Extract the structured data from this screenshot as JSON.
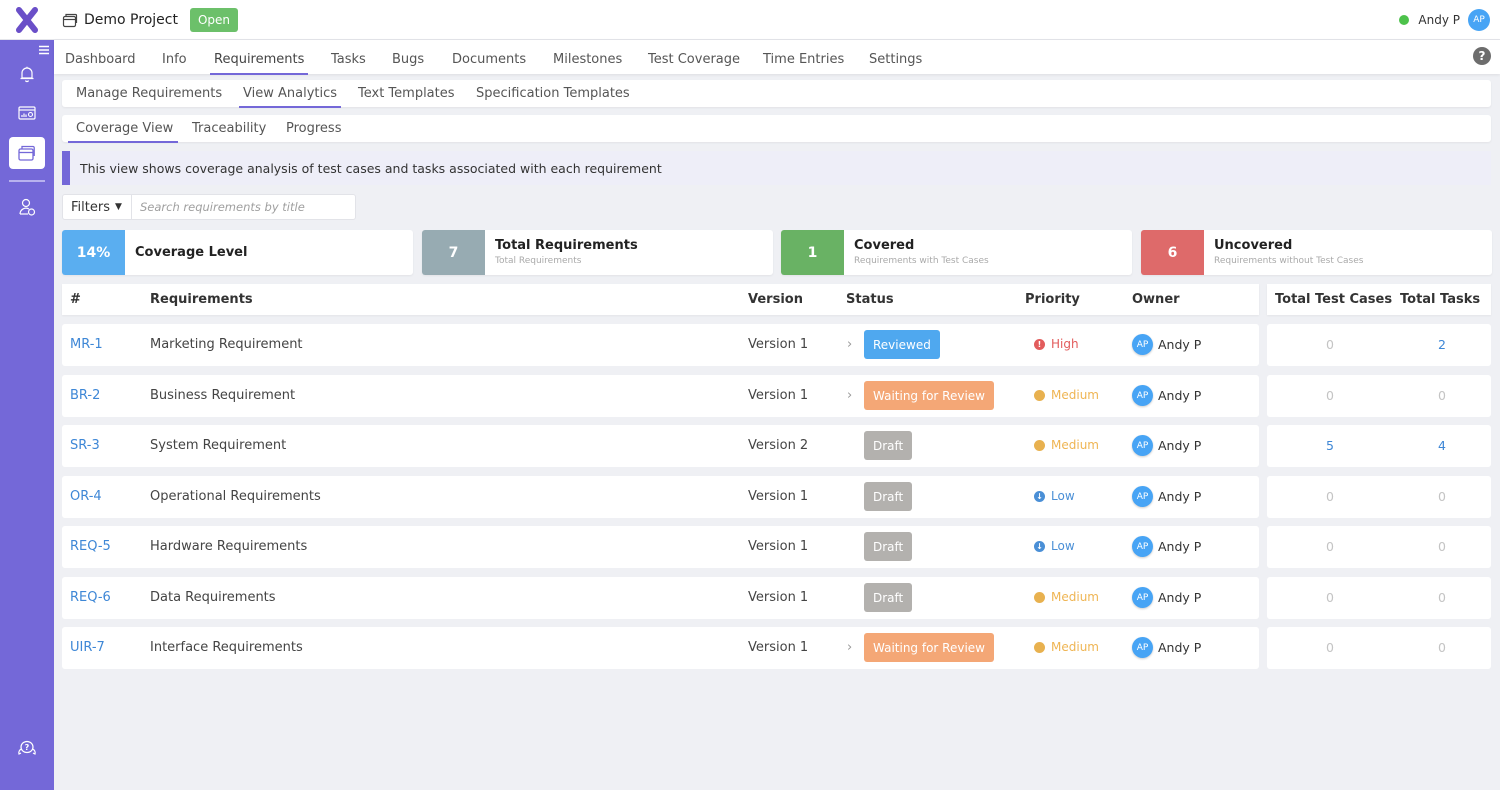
{
  "app": {
    "logo_letter": "X"
  },
  "header": {
    "project_name": "Demo Project",
    "project_status": "Open",
    "user_name": "Andy P",
    "user_initials": "AP"
  },
  "sidebar": {
    "items": [
      {
        "name": "notifications",
        "icon": "bell-icon"
      },
      {
        "name": "dashboard",
        "icon": "dashboard-chart-icon"
      },
      {
        "name": "projects",
        "icon": "folder-icon",
        "active": true
      },
      {
        "name": "users",
        "icon": "user-settings-icon"
      }
    ],
    "bottom_icon": "help-chat-icon"
  },
  "main_nav": {
    "tabs": [
      "Dashboard",
      "Info",
      "Requirements",
      "Tasks",
      "Bugs",
      "Documents",
      "Milestones",
      "Test Coverage",
      "Time Entries",
      "Settings"
    ],
    "active": "Requirements"
  },
  "sub_nav": {
    "tabs": [
      "Manage Requirements",
      "View Analytics",
      "Text Templates",
      "Specification Templates"
    ],
    "active": "View Analytics"
  },
  "analytics_nav": {
    "tabs": [
      "Coverage View",
      "Traceability",
      "Progress"
    ],
    "active": "Coverage View"
  },
  "info_text": "This view shows coverage analysis of test cases and tasks associated with each requirement",
  "filters": {
    "label": "Filters",
    "search_placeholder": "Search requirements by title"
  },
  "stats": [
    {
      "value": "14%",
      "title": "Coverage Level",
      "subtitle": "",
      "color": "#5aaef0"
    },
    {
      "value": "7",
      "title": "Total Requirements",
      "subtitle": "Total Requirements",
      "color": "#97abb2"
    },
    {
      "value": "1",
      "title": "Covered",
      "subtitle": "Requirements with Test Cases",
      "color": "#69b264"
    },
    {
      "value": "6",
      "title": "Uncovered",
      "subtitle": "Requirements without Test Cases",
      "color": "#de6a6a"
    }
  ],
  "table": {
    "columns": [
      "#",
      "Requirements",
      "Version",
      "Status",
      "Priority",
      "Owner",
      "Total Test Cases",
      "Total Tasks"
    ],
    "rows": [
      {
        "id": "MR-1",
        "title": "Marketing Requirement",
        "version": "Version 1",
        "expandable": true,
        "status": "Reviewed",
        "priority": "High",
        "owner": "Andy P",
        "owner_initials": "AP",
        "test_cases": "0",
        "tasks": "2"
      },
      {
        "id": "BR-2",
        "title": "Business Requirement",
        "version": "Version 1",
        "expandable": true,
        "status": "Waiting for Review",
        "priority": "Medium",
        "owner": "Andy P",
        "owner_initials": "AP",
        "test_cases": "0",
        "tasks": "0"
      },
      {
        "id": "SR-3",
        "title": "System Requirement",
        "version": "Version 2",
        "expandable": false,
        "status": "Draft",
        "priority": "Medium",
        "owner": "Andy P",
        "owner_initials": "AP",
        "test_cases": "5",
        "tasks": "4"
      },
      {
        "id": "OR-4",
        "title": "Operational Requirements",
        "version": "Version 1",
        "expandable": false,
        "status": "Draft",
        "priority": "Low",
        "owner": "Andy P",
        "owner_initials": "AP",
        "test_cases": "0",
        "tasks": "0"
      },
      {
        "id": "REQ-5",
        "title": "Hardware Requirements",
        "version": "Version 1",
        "expandable": false,
        "status": "Draft",
        "priority": "Low",
        "owner": "Andy P",
        "owner_initials": "AP",
        "test_cases": "0",
        "tasks": "0"
      },
      {
        "id": "REQ-6",
        "title": "Data Requirements",
        "version": "Version 1",
        "expandable": false,
        "status": "Draft",
        "priority": "Medium",
        "owner": "Andy P",
        "owner_initials": "AP",
        "test_cases": "0",
        "tasks": "0"
      },
      {
        "id": "UIR-7",
        "title": "Interface Requirements",
        "version": "Version 1",
        "expandable": true,
        "status": "Waiting for Review",
        "priority": "Medium",
        "owner": "Andy P",
        "owner_initials": "AP",
        "test_cases": "0",
        "tasks": "0"
      }
    ]
  },
  "colors": {
    "accent": "#7468d8",
    "status": {
      "Reviewed": "#4fa8ef",
      "Waiting for Review": "#f4a776",
      "Draft": "#b3b1ae"
    },
    "priority": {
      "High": "#e25c5c",
      "Medium": "#e8b14f",
      "Low": "#4a8fd6"
    },
    "priority_text": {
      "High": "#e25c5c",
      "Medium": "#efb553",
      "Low": "#4a8fd6"
    }
  }
}
